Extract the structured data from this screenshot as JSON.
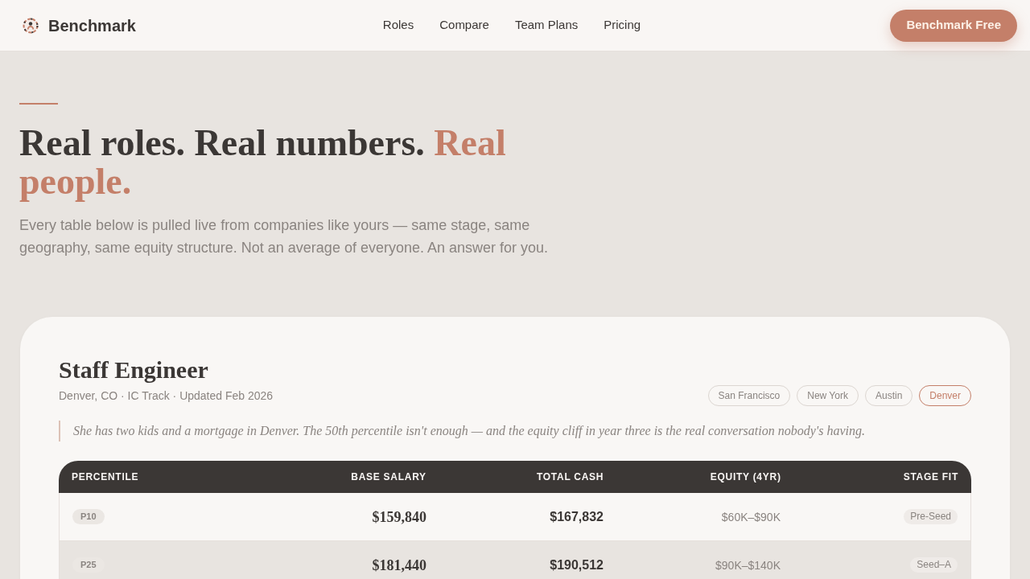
{
  "nav": {
    "brand": "Benchmark",
    "links": [
      {
        "label": "Roles"
      },
      {
        "label": "Compare"
      },
      {
        "label": "Team Plans"
      },
      {
        "label": "Pricing"
      }
    ],
    "cta": "Benchmark Free"
  },
  "hero": {
    "title": "Real roles. Real numbers.",
    "title_accent": "Real people.",
    "lead": "Every table below is pulled live from companies like yours — same stage, same geography, same equity structure. Not an average of everyone. An answer for you."
  },
  "role_card": {
    "title": "Staff Engineer",
    "meta": "Denver, CO · IC Track · Updated Feb 2026",
    "cities": [
      {
        "label": "San Francisco",
        "selected": false
      },
      {
        "label": "New York",
        "selected": false
      },
      {
        "label": "Austin",
        "selected": false
      },
      {
        "label": "Denver",
        "selected": true
      }
    ],
    "quote": "She has two kids and a mortgage in Denver. The 50th percentile isn't enough — and the equity cliff in year three is the real conversation nobody's having.",
    "table": {
      "columns": [
        "PERCENTILE",
        "BASE SALARY",
        "TOTAL CASH",
        "EQUITY (4YR)",
        "STAGE FIT"
      ],
      "rows": [
        {
          "percentile": "P10",
          "base_salary": "$159,840",
          "total_cash": "$167,832",
          "equity": "$60K–$90K",
          "stage_fit": "Pre-Seed"
        },
        {
          "percentile": "P25",
          "base_salary": "$181,440",
          "total_cash": "$190,512",
          "equity": "$90K–$140K",
          "stage_fit": "Seed–A"
        }
      ]
    }
  }
}
